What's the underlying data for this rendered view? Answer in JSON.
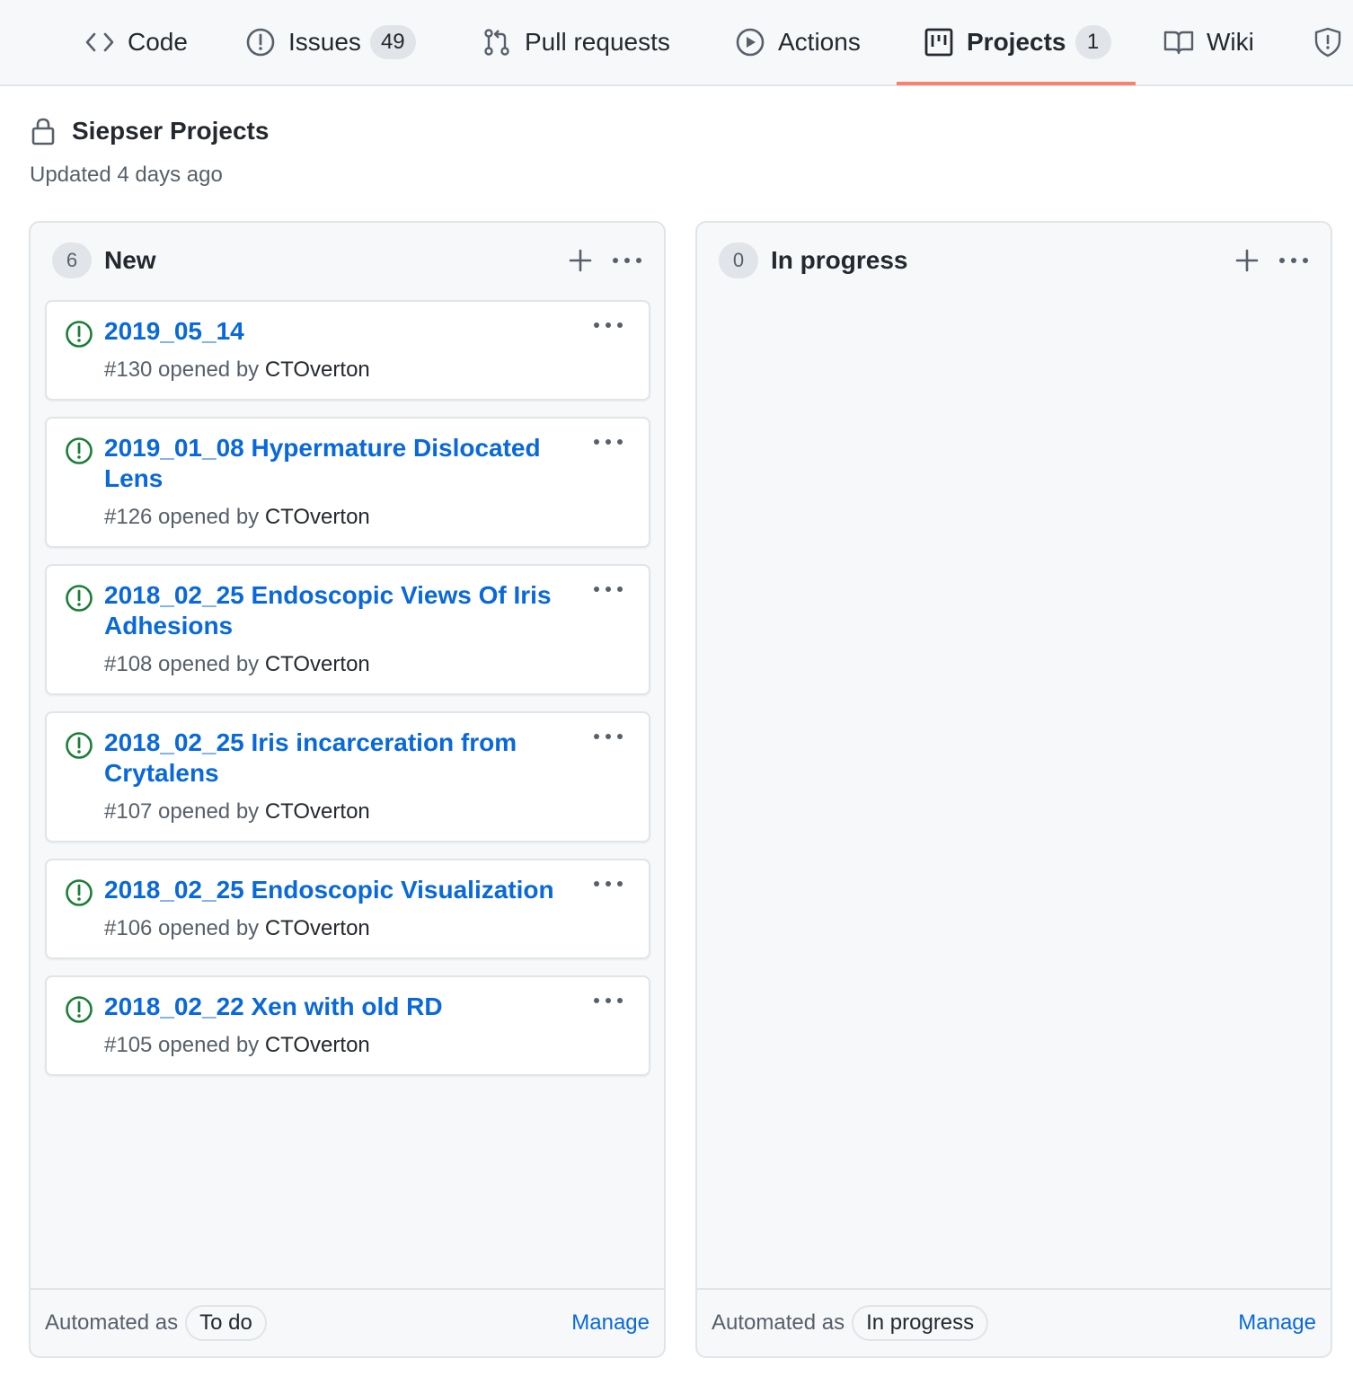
{
  "nav": {
    "tabs": [
      {
        "label": "Code",
        "icon": "code-icon"
      },
      {
        "label": "Issues",
        "icon": "issue-opened-icon",
        "count": "49"
      },
      {
        "label": "Pull requests",
        "icon": "git-pull-request-icon"
      },
      {
        "label": "Actions",
        "icon": "play-icon"
      },
      {
        "label": "Projects",
        "icon": "project-icon",
        "count": "1",
        "active": true
      },
      {
        "label": "Wiki",
        "icon": "book-icon"
      },
      {
        "label": "",
        "icon": "shield-icon"
      }
    ],
    "active_underline_color": "#f9826c"
  },
  "project": {
    "name": "Siepser Projects",
    "updated": "Updated 4 days ago",
    "visibility_icon": "lock-icon"
  },
  "columns": [
    {
      "count": "6",
      "name": "New",
      "automated_label": "Automated as",
      "automated_value": "To do",
      "manage_label": "Manage",
      "cards": [
        {
          "title": "2019_05_14",
          "meta_prefix": "#130 opened by ",
          "author": "CTOverton"
        },
        {
          "title": "2019_01_08 Hypermature Dislocated Lens",
          "meta_prefix": "#126 opened by ",
          "author": "CTOverton"
        },
        {
          "title": "2018_02_25 Endoscopic Views Of Iris Adhesions",
          "meta_prefix": "#108 opened by ",
          "author": "CTOverton"
        },
        {
          "title": "2018_02_25 Iris incarceration from Crytalens",
          "meta_prefix": "#107 opened by ",
          "author": "CTOverton"
        },
        {
          "title": "2018_02_25 Endoscopic Visualization",
          "meta_prefix": "#106 opened by ",
          "author": "CTOverton"
        },
        {
          "title": "2018_02_22 Xen with old RD",
          "meta_prefix": "#105 opened by ",
          "author": "CTOverton"
        }
      ]
    },
    {
      "count": "0",
      "name": "In progress",
      "automated_label": "Automated as",
      "automated_value": "In progress",
      "manage_label": "Manage",
      "cards": []
    }
  ],
  "colors": {
    "link": "#0969da",
    "issue_open": "#1a7f37",
    "muted": "#57606a"
  }
}
